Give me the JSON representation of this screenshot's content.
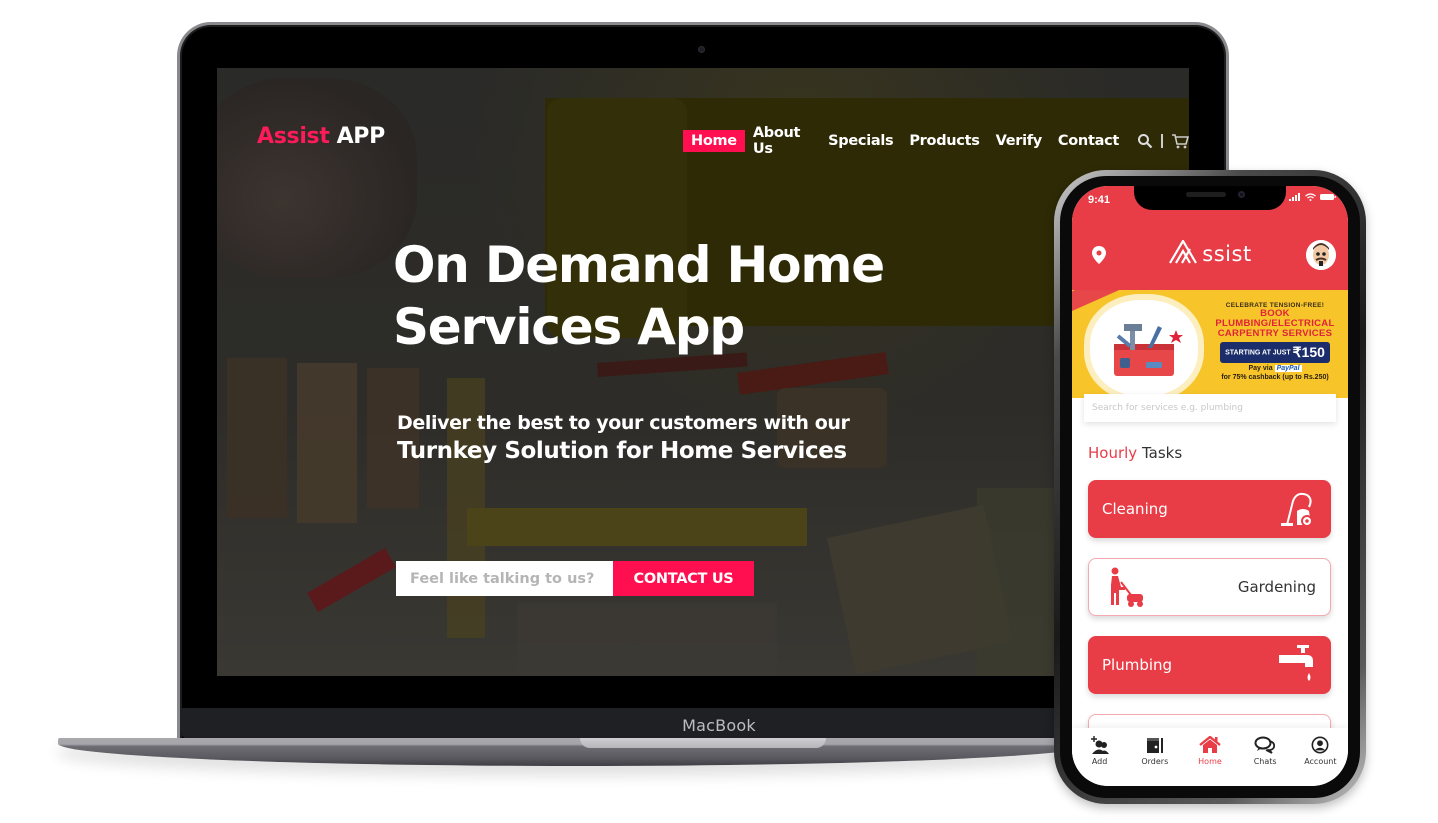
{
  "laptop": {
    "brand_label": "MacBook",
    "website": {
      "logo": {
        "brand": "Assist",
        "suffix": "APP"
      },
      "nav": {
        "items": [
          {
            "label": "Home",
            "active": true
          },
          {
            "label": "About Us",
            "active": false
          },
          {
            "label": "Specials",
            "active": false
          },
          {
            "label": "Products",
            "active": false
          },
          {
            "label": "Verify",
            "active": false
          },
          {
            "label": "Contact",
            "active": false
          }
        ],
        "icons": [
          "search-icon",
          "cart-icon"
        ]
      },
      "hero": {
        "title_line1": "On Demand Home",
        "title_line2": "Services App",
        "subtitle_line1": "Deliver the best to your customers with our",
        "subtitle_line2": "Turnkey Solution for Home Services"
      },
      "contact": {
        "input_placeholder": "Feel like talking to us?",
        "button_label": "CONTACT US"
      }
    }
  },
  "phone": {
    "status_bar": {
      "time": "9:41"
    },
    "header": {
      "logo_text": "ssist",
      "logo_mark": "A"
    },
    "banner": {
      "kicker": "CELEBRATE TENSION-FREE!",
      "line1": "BOOK",
      "line2": "PLUMBING/ELECTRICAL",
      "line3": "CARPENTRY SERVICES",
      "price_prefix": "STARTING AT JUST",
      "price": "₹150",
      "pay_via": "Pay via",
      "pay_brand": "PayPal",
      "cashback": "for 75% cashback (up to Rs.250)"
    },
    "search": {
      "placeholder": "Search for services e.g. plumbing"
    },
    "section": {
      "highlight": "Hourly",
      "rest": "Tasks"
    },
    "tasks": [
      {
        "label": "Cleaning",
        "icon": "vacuum-cleaner-icon",
        "style": "filled"
      },
      {
        "label": "Gardening",
        "icon": "lawn-mower-icon",
        "style": "outline"
      },
      {
        "label": "Plumbing",
        "icon": "faucet-icon",
        "style": "filled"
      }
    ],
    "tabbar": [
      {
        "label": "Add",
        "icon": "add-user-icon",
        "active": false
      },
      {
        "label": "Orders",
        "icon": "orders-icon",
        "active": false
      },
      {
        "label": "Home",
        "icon": "home-icon",
        "active": true
      },
      {
        "label": "Chats",
        "icon": "chat-icon",
        "active": false
      },
      {
        "label": "Account",
        "icon": "account-icon",
        "active": false
      }
    ]
  },
  "colors": {
    "web_accent": "#ff0f4f",
    "app_accent": "#e83d47",
    "banner_yellow": "#f7c52a",
    "banner_price_bg": "#1b2d6b"
  }
}
